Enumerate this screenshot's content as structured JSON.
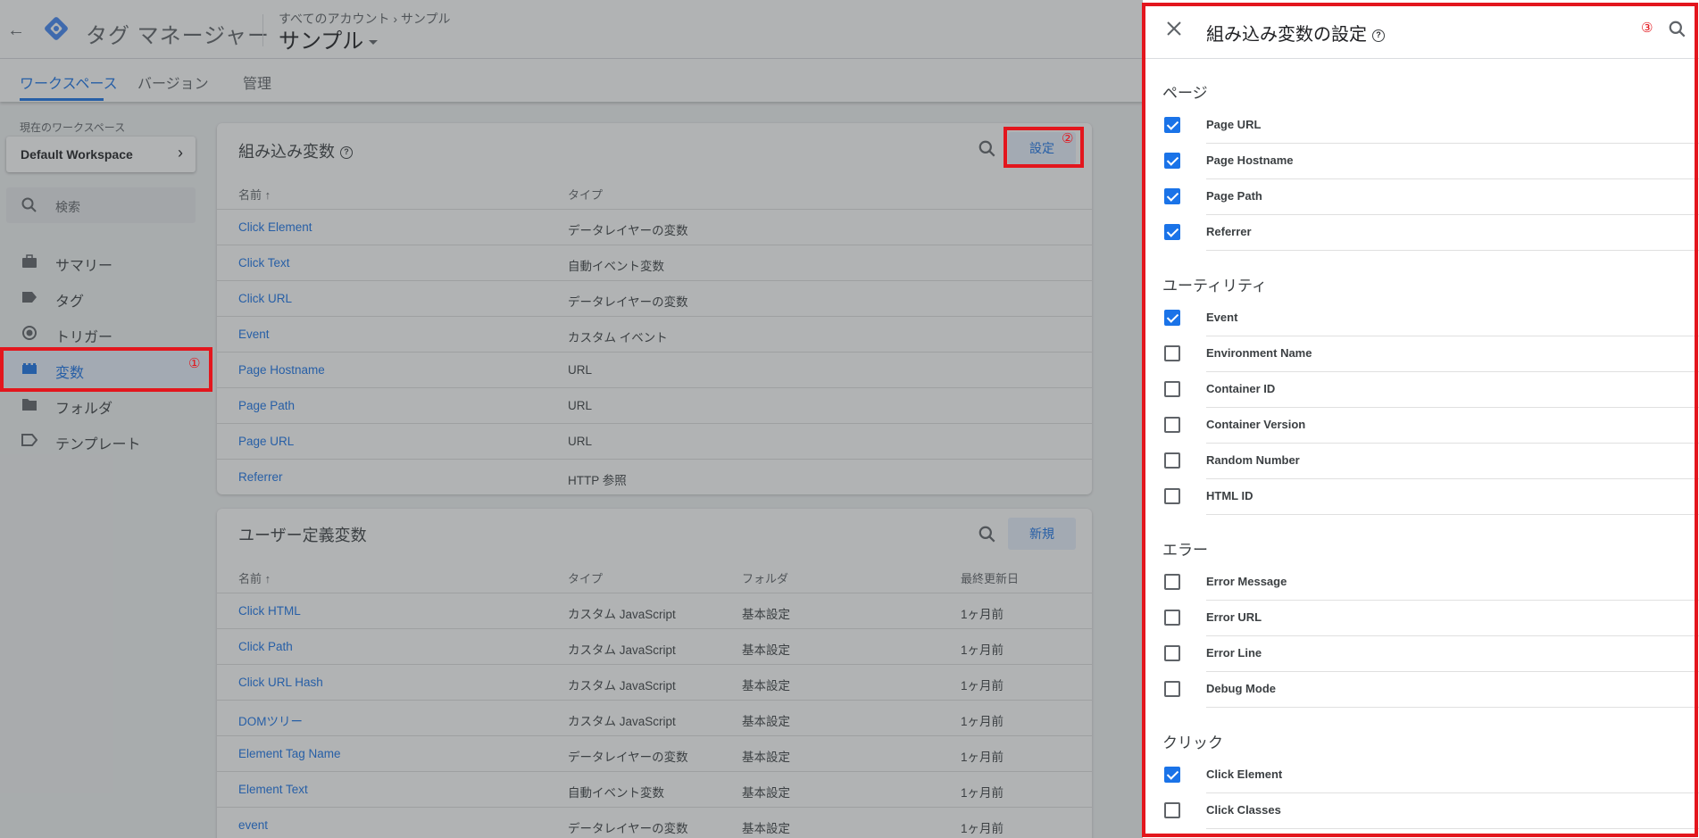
{
  "header": {
    "app_title": "タグ マネージャー",
    "breadcrumb": "すべてのアカウント › サンプル",
    "container_name": "サンプル"
  },
  "tabs": [
    {
      "label": "ワークスペース"
    },
    {
      "label": "バージョン"
    },
    {
      "label": "管理"
    }
  ],
  "sidebar": {
    "workspace_label": "現在のワークスペース",
    "workspace_name": "Default Workspace",
    "search_placeholder": "検索",
    "items": [
      {
        "label": "サマリー",
        "icon": "briefcase-icon"
      },
      {
        "label": "タグ",
        "icon": "tag-icon"
      },
      {
        "label": "トリガー",
        "icon": "trigger-icon"
      },
      {
        "label": "変数",
        "icon": "variables-icon"
      },
      {
        "label": "フォルダ",
        "icon": "folder-icon"
      },
      {
        "label": "テンプレート",
        "icon": "template-icon"
      }
    ]
  },
  "builtin_card": {
    "title": "組み込み変数",
    "button": "設定",
    "col_name": "名前 ↑",
    "col_type": "タイプ",
    "rows": [
      {
        "name": "Click Element",
        "type": "データレイヤーの変数"
      },
      {
        "name": "Click Text",
        "type": "自動イベント変数"
      },
      {
        "name": "Click URL",
        "type": "データレイヤーの変数"
      },
      {
        "name": "Event",
        "type": "カスタム イベント"
      },
      {
        "name": "Page Hostname",
        "type": "URL"
      },
      {
        "name": "Page Path",
        "type": "URL"
      },
      {
        "name": "Page URL",
        "type": "URL"
      },
      {
        "name": "Referrer",
        "type": "HTTP 参照"
      }
    ]
  },
  "user_card": {
    "title": "ユーザー定義変数",
    "button": "新規",
    "col_name": "名前 ↑",
    "col_type": "タイプ",
    "col_folder": "フォルダ",
    "col_updated": "最終更新日",
    "rows": [
      {
        "name": "Click HTML",
        "type": "カスタム JavaScript",
        "folder": "基本設定",
        "updated": "1ヶ月前"
      },
      {
        "name": "Click Path",
        "type": "カスタム JavaScript",
        "folder": "基本設定",
        "updated": "1ヶ月前"
      },
      {
        "name": "Click URL Hash",
        "type": "カスタム JavaScript",
        "folder": "基本設定",
        "updated": "1ヶ月前"
      },
      {
        "name": "DOMツリー",
        "type": "カスタム JavaScript",
        "folder": "基本設定",
        "updated": "1ヶ月前"
      },
      {
        "name": "Element Tag Name",
        "type": "データレイヤーの変数",
        "folder": "基本設定",
        "updated": "1ヶ月前"
      },
      {
        "name": "Element Text",
        "type": "自動イベント変数",
        "folder": "基本設定",
        "updated": "1ヶ月前"
      },
      {
        "name": "event",
        "type": "データレイヤーの変数",
        "folder": "基本設定",
        "updated": "1ヶ月前"
      }
    ]
  },
  "annotations": {
    "one": "①",
    "two": "②",
    "three": "③"
  },
  "panel": {
    "title": "組み込み変数の設定",
    "sections": [
      {
        "title": "ページ",
        "items": [
          {
            "label": "Page URL",
            "checked": true
          },
          {
            "label": "Page Hostname",
            "checked": true
          },
          {
            "label": "Page Path",
            "checked": true
          },
          {
            "label": "Referrer",
            "checked": true
          }
        ]
      },
      {
        "title": "ユーティリティ",
        "items": [
          {
            "label": "Event",
            "checked": true
          },
          {
            "label": "Environment Name",
            "checked": false
          },
          {
            "label": "Container ID",
            "checked": false
          },
          {
            "label": "Container Version",
            "checked": false
          },
          {
            "label": "Random Number",
            "checked": false
          },
          {
            "label": "HTML ID",
            "checked": false
          }
        ]
      },
      {
        "title": "エラー",
        "items": [
          {
            "label": "Error Message",
            "checked": false
          },
          {
            "label": "Error URL",
            "checked": false
          },
          {
            "label": "Error Line",
            "checked": false
          },
          {
            "label": "Debug Mode",
            "checked": false
          }
        ]
      },
      {
        "title": "クリック",
        "items": [
          {
            "label": "Click Element",
            "checked": true
          },
          {
            "label": "Click Classes",
            "checked": false
          }
        ]
      }
    ]
  },
  "colors": {
    "accent": "#1a73e8",
    "annotation": "#e3161d"
  }
}
